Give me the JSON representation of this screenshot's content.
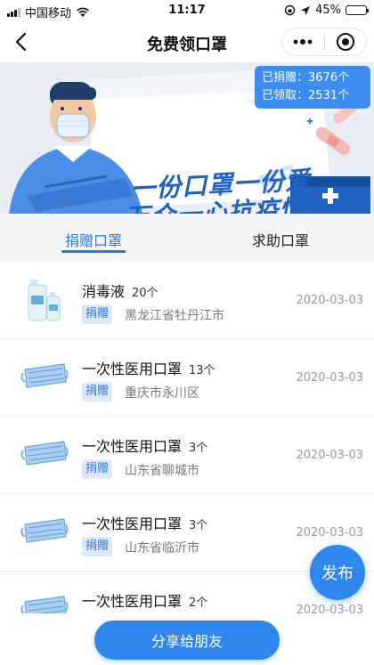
{
  "status_bar": {
    "carrier": "中国移动",
    "time": "11:17",
    "battery": "45%"
  },
  "nav": {
    "title": "免费领口罩"
  },
  "banner": {
    "donated_label": "已捐赠：",
    "donated_value": "3676个",
    "received_label": "已领取：",
    "received_value": "2531个",
    "slogan_line1": "一份口罩一份爱",
    "slogan_line2": "万众一心抗疫情"
  },
  "tabs": [
    {
      "label": "捐赠口罩",
      "active": true
    },
    {
      "label": "求助口罩",
      "active": false
    }
  ],
  "items": [
    {
      "name": "消毒液",
      "qty": "20个",
      "tag": "捐赠",
      "location": "黑龙江省牡丹江市",
      "date": "2020-03-03",
      "icon": "sanitizer-bottles"
    },
    {
      "name": "一次性医用口罩",
      "qty": "13个",
      "tag": "捐赠",
      "location": "重庆市永川区",
      "date": "2020-03-03",
      "icon": "face-mask"
    },
    {
      "name": "一次性医用口罩",
      "qty": "3个",
      "tag": "捐赠",
      "location": "山东省聊城市",
      "date": "2020-03-03",
      "icon": "face-mask"
    },
    {
      "name": "一次性医用口罩",
      "qty": "3个",
      "tag": "捐赠",
      "location": "山东省临沂市",
      "date": "2020-03-03",
      "icon": "face-mask"
    },
    {
      "name": "一次性医用口罩",
      "qty": "2个",
      "tag": "捐赠",
      "location": "",
      "date": "2020-03-03",
      "icon": "face-mask"
    }
  ],
  "actions": {
    "publish_label": "发布",
    "share_label": "分享给朋友"
  },
  "colors": {
    "accent": "#2f86ec",
    "tag_bg": "#dde8f8"
  }
}
